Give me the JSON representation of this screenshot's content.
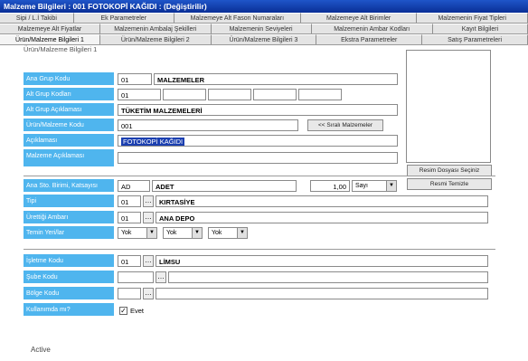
{
  "window": {
    "title": "Malzeme Bilgileri : 001 FOTOKOPİ KAĞIDI : (Değiştirilir)"
  },
  "tabs": {
    "row1": [
      "Sipi / L.İ Takibi",
      "Ek Parametreler",
      "Malzemeye Alt Fason Numaraları",
      "Malzemeye Alt Birimler",
      "Malzemenin Fiyat Tipleri"
    ],
    "row2": [
      "Malzemeye Alt Fiyatlar",
      "Malzemenin Ambalaj Şekilleri",
      "Malzemenin Seviyeleri",
      "Malzemenin Ambar Kodları",
      "Kayıt Bilgileri"
    ],
    "row3": [
      "Ürün/Malzeme Bilgileri 1",
      "Ürün/Malzeme Bilgileri 2",
      "Ürün/Malzeme Bilgileri 3",
      "Ekstra Parametreler",
      "Satış Parametreleri"
    ]
  },
  "section": {
    "title": "Ürün/Malzeme Bilgileri 1"
  },
  "labels": {
    "ana_grup": "Ana Grup Kodu",
    "alt_grup": "Alt Grup Kodları",
    "alt_grup_aciklama": "Alt Grup Açıklaması",
    "urun_kodu": "Ürün/Malzeme Kodu",
    "aciklama": "Açıklaması",
    "malzeme_aciklama": "Malzeme Açıklaması",
    "birim": "Ana Sto. Birimi, Katsayısı",
    "tipi": "Tipi",
    "ambar": "Ürettiği Ambarı",
    "temin": "Temin Yeri/lar",
    "isletme": "İşletme Kodu",
    "sube": "Şube Kodu",
    "bolge": "Bölge Kodu",
    "kullanimda": "Kullanımda mı?"
  },
  "fields": {
    "ana_grup_code": "01",
    "ana_grup_name": "MALZEMELER",
    "alt_grup_code": "01",
    "alt_grup_aciklama": "TÜKETİM MALZEMELERİ",
    "urun_kodu": "001",
    "aciklama": "FOTOKOPİ KAĞIDI",
    "malzeme_aciklama": "",
    "birim_code": "AD",
    "birim_name": "ADET",
    "birim_katsayi": "1,00",
    "birim_combo": "Sayı",
    "tipi_code": "01",
    "tipi_name": "KIRTASİYE",
    "ambar_code": "01",
    "ambar_name": "ANA DEPO",
    "temin_1": "Yok",
    "temin_2": "Yok",
    "temin_3": "Yok",
    "isletme_code": "01",
    "isletme_name": "LİMSU",
    "sube_code": "",
    "bolge_code": "",
    "kullanimda_label": "Evet"
  },
  "buttons": {
    "sirali_malzemeler": "<< Sıralı Malzemeler",
    "resim_getir": "Resim Dosyası Seçiniz",
    "resmi_temizle": "Resmi Temizle"
  },
  "status": {
    "text": "Active"
  },
  "colors": {
    "titlebar": "#1f55c9",
    "label_bg": "#4fb5ee",
    "selection": "#1b3fb0"
  }
}
